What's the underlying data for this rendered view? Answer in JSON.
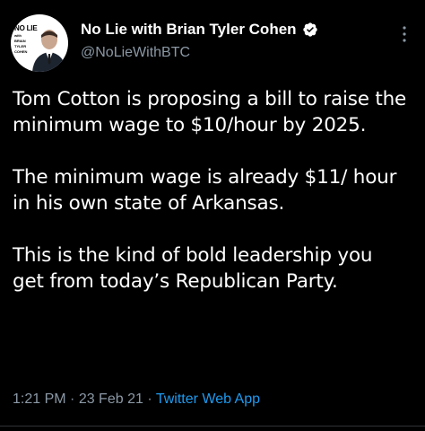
{
  "author": {
    "display_name": "No Lie with Brian Tyler Cohen",
    "handle": "@NoLieWithBTC",
    "verified": true,
    "avatar": {
      "wordmark_line1": "NO LIE",
      "wordmark_line2": "with",
      "wordmark_line3": "BRIAN",
      "wordmark_line4": "TYLER",
      "wordmark_line5": "COHEN"
    }
  },
  "tweet": {
    "paragraphs": [
      "Tom Cotton is proposing a bill to raise the minimum wage to $10/hour by 2025.",
      "The minimum wage is already $11/ hour in his own state of Arkansas.",
      "This is the kind of bold leadership you get from today’s Republican Party."
    ],
    "time": "1:21 PM",
    "date": "23 Feb 21",
    "separator": " · ",
    "source": "Twitter Web App"
  },
  "colors": {
    "background": "#000000",
    "text": "#ffffff",
    "muted": "#8b98a5",
    "accent": "#1d9bf0",
    "divider": "#2f3336"
  },
  "icons": {
    "verified": "verified-badge-icon",
    "more": "more-vertical-icon"
  }
}
